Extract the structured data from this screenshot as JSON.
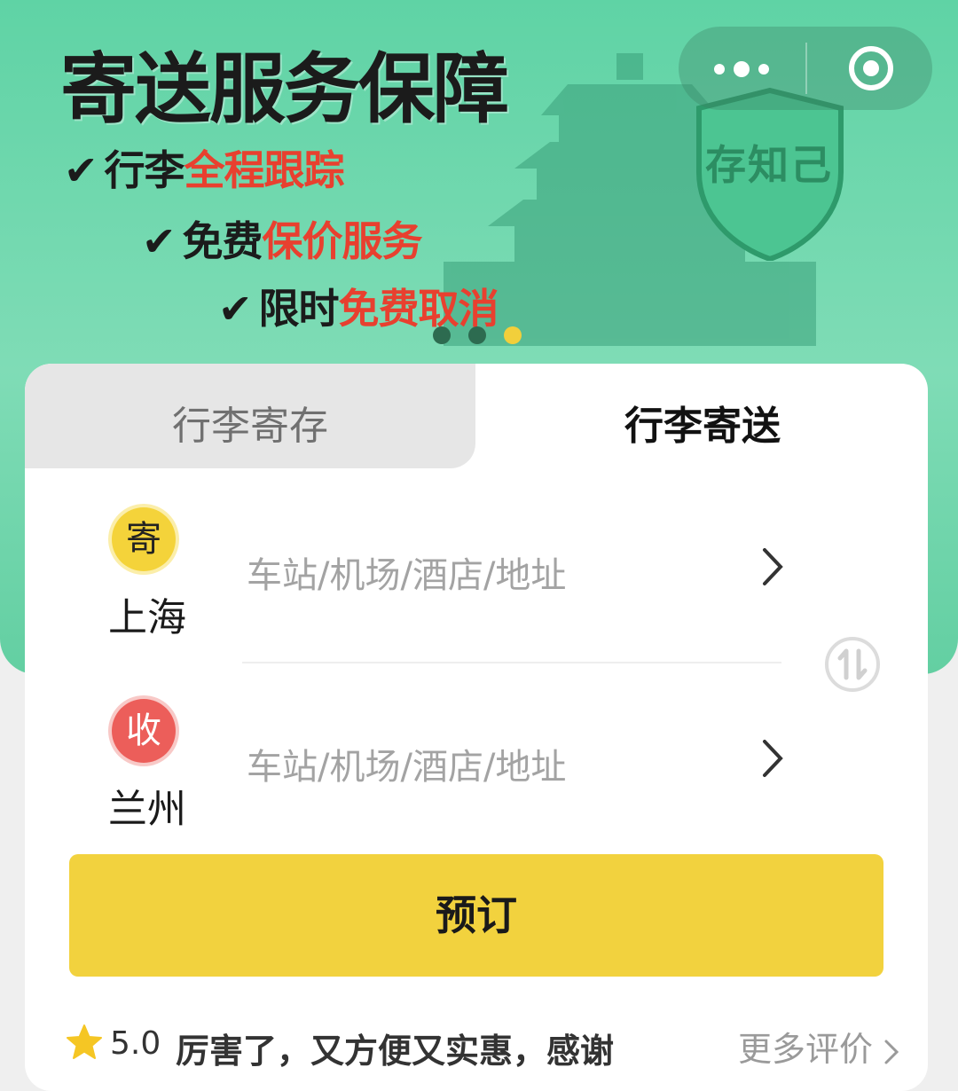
{
  "banner": {
    "title": "寄送服务保障",
    "features": [
      {
        "check": "✔",
        "prefix": "行李",
        "highlight": "全程跟踪"
      },
      {
        "check": "✔",
        "prefix": "免费",
        "highlight": "保价服务"
      },
      {
        "check": "✔",
        "prefix": "限时",
        "highlight": "免费取消"
      }
    ],
    "shield_text": "存知己",
    "carousel_active_index": 2,
    "carousel_count": 3
  },
  "capsule": {
    "more_icon": "more-dots-icon",
    "close_icon": "target-icon"
  },
  "tabs": {
    "storage": "行李寄存",
    "shipping": "行李寄送",
    "active": "shipping"
  },
  "sender": {
    "badge": "寄",
    "city": "上海",
    "placeholder": "车站/机场/酒店/地址"
  },
  "receiver": {
    "badge": "收",
    "city": "兰州",
    "placeholder": "车站/机场/酒店/地址"
  },
  "book_button": "预订",
  "review": {
    "score": "5.0",
    "text": "厉害了，又方便又实惠，感谢",
    "more": "更多评价"
  },
  "colors": {
    "banner_green": "#5fd3a5",
    "accent_yellow": "#f2d23e",
    "receive_red": "#ec5e5a",
    "highlight_red": "#e8402f"
  }
}
